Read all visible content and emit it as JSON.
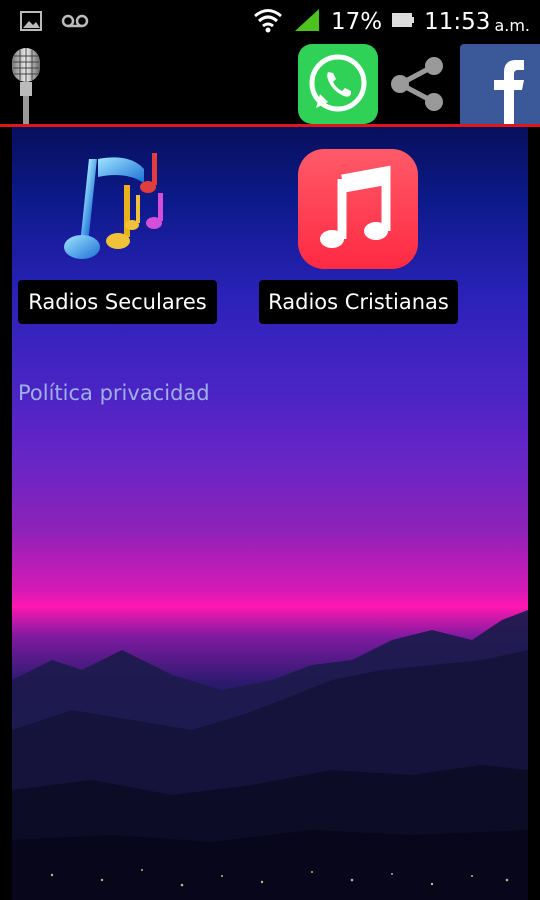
{
  "status_bar": {
    "battery_percent": "17%",
    "time": "11:53",
    "ampm": "a.m.",
    "icons": [
      "image-icon",
      "voicemail-icon",
      "wifi-icon",
      "signal-icon",
      "battery-icon"
    ]
  },
  "top_bar": {
    "icons": [
      "microphone-icon",
      "whatsapp-icon",
      "share-icon",
      "facebook-icon"
    ],
    "accent_line_color": "#e0161b"
  },
  "apps": [
    {
      "label": "Radios Seculares",
      "icon": "music-notes-icon"
    },
    {
      "label": "Radios Cristianas",
      "icon": "apple-music-icon"
    }
  ],
  "links": {
    "privacy": "Política privacidad"
  }
}
